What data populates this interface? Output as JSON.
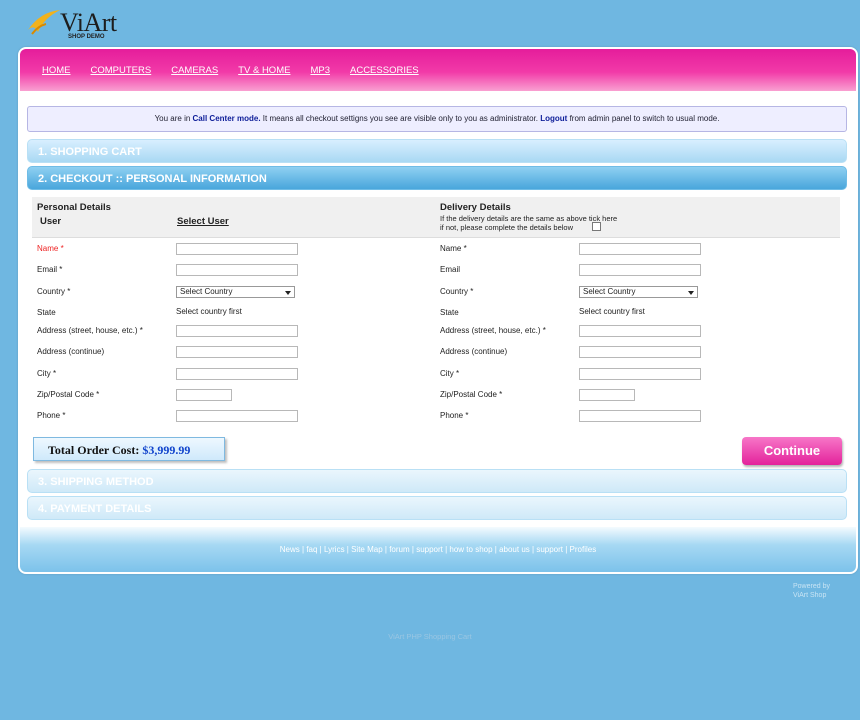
{
  "logo": {
    "brand": "ViArt",
    "sub": "SHOP DEMO"
  },
  "nav": [
    "HOME",
    "COMPUTERS",
    "CAMERAS",
    "TV & HOME",
    "MP3",
    "ACCESSORIES"
  ],
  "notice": {
    "pre": "You are in ",
    "mode": "Call Center mode.",
    "mid": " It means all checkout settigns you see are visible only to you as administrator. ",
    "logout": "Logout",
    "post": " from admin panel to switch to usual mode."
  },
  "steps": {
    "cart": "1. SHOPPING CART",
    "checkout": "2. CHECKOUT :: PERSONAL INFORMATION",
    "shipping": "3. SHIPPING METHOD",
    "payment": "4. PAYMENT DETAILS"
  },
  "personal": {
    "title": "Personal Details",
    "user_label": "User",
    "select_user": "Select User",
    "fields": {
      "name": "Name *",
      "email": "Email *",
      "country": "Country *",
      "state": "State",
      "address": "Address (street, house, etc.) *",
      "address2": "Address (continue)",
      "city": "City *",
      "zip": "Zip/Postal Code *",
      "phone": "Phone *"
    },
    "country_select": "Select Country",
    "state_hint": "Select country first"
  },
  "delivery": {
    "title": "Delivery Details",
    "line1": "If the delivery details are the same as above tick here",
    "line2": "if not, please complete the details below",
    "fields": {
      "name": "Name *",
      "email": "Email",
      "country": "Country *",
      "state": "State",
      "address": "Address (street, house, etc.) *",
      "address2": "Address (continue)",
      "city": "City *",
      "zip": "Zip/Postal Code *",
      "phone": "Phone *"
    },
    "country_select": "Select Country",
    "state_hint": "Select country first"
  },
  "total": {
    "label": "Total Order Cost: ",
    "amount": "$3,999.99"
  },
  "continue_label": "Continue",
  "footer_links": [
    "News",
    "faq",
    "Lyrics",
    "Site Map",
    "forum",
    "support",
    "how to shop",
    "about us",
    "support",
    "Profiles"
  ],
  "powered": {
    "line1": "Powered by",
    "line2": "ViArt Shop"
  },
  "cart_line": "ViArt PHP Shopping Cart",
  "colors": {
    "background": "#6fb7e1",
    "nav_pink": "#e51d9b",
    "accent_blue": "#1144cc"
  }
}
